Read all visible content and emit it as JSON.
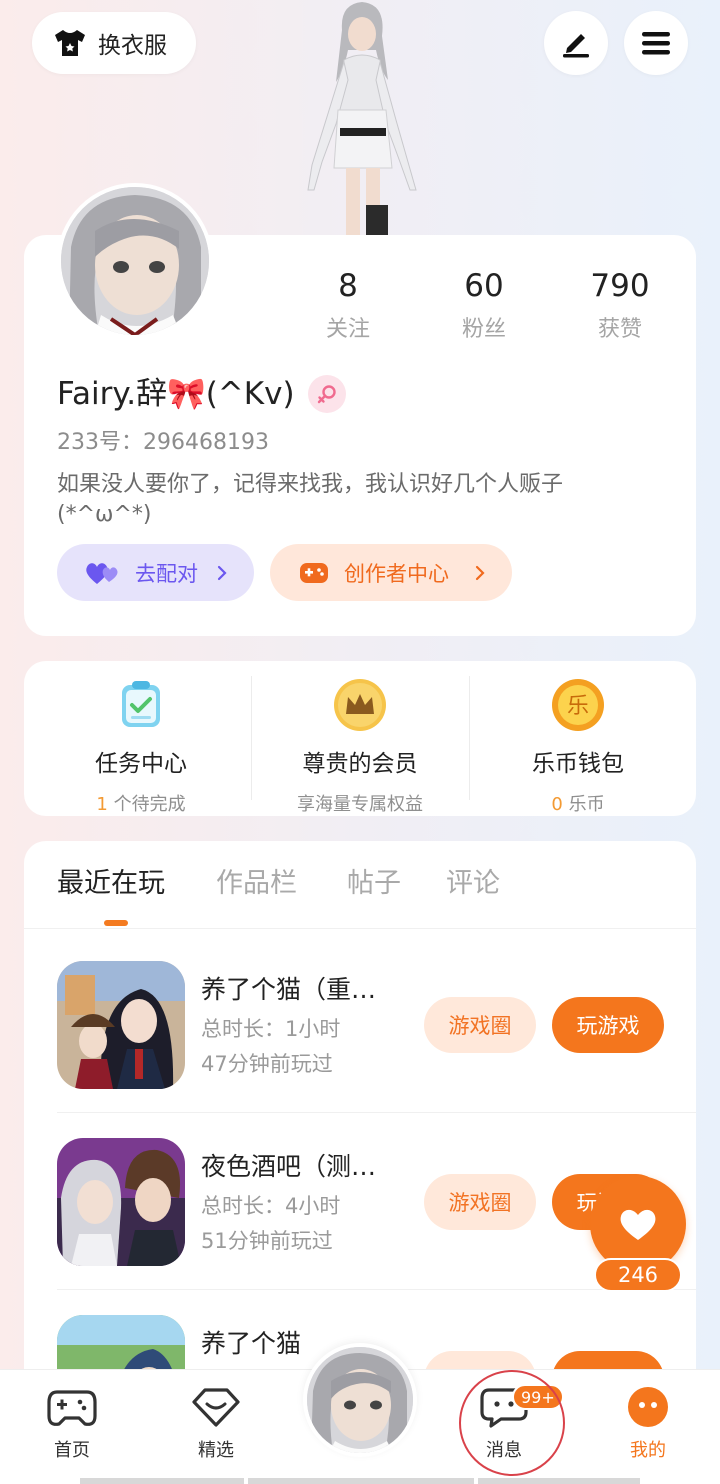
{
  "header": {
    "outfit_label": "换衣服"
  },
  "profile": {
    "stats": [
      {
        "value": "8",
        "label": "关注"
      },
      {
        "value": "60",
        "label": "粉丝"
      },
      {
        "value": "790",
        "label": "获赞"
      }
    ],
    "username": "Fairy.辞🎀(^Kv)",
    "uid": "233号：296468193",
    "bio": "如果没人要你了，记得来找我，我认识好几个人贩子(*^ω^*)",
    "match_label": "去配对",
    "creator_label": "创作者中心"
  },
  "services": [
    {
      "title": "任务中心",
      "count": "1",
      "sub": " 个待完成"
    },
    {
      "title": "尊贵的会员",
      "count": "",
      "sub": "享海量专属权益"
    },
    {
      "title": "乐币钱包",
      "count": "0",
      "sub": " 乐币"
    }
  ],
  "tabs": [
    "最近在玩",
    "作品栏",
    "帖子",
    "评论"
  ],
  "games": [
    {
      "title": "养了个猫（重…",
      "duration": "总时长：1小时",
      "last": "47分钟前玩过",
      "circle": "游戏圈",
      "play": "玩游戏"
    },
    {
      "title": "夜色酒吧（测…",
      "duration": "总时长：4小时",
      "last": "51分钟前玩过",
      "circle": "游戏圈",
      "play": "玩游戏"
    },
    {
      "title": "养了个猫",
      "duration": "",
      "last": "",
      "circle": "",
      "play": ""
    }
  ],
  "float_like": {
    "count": "246"
  },
  "nav": {
    "home": "首页",
    "featured": "精选",
    "messages": "消息",
    "messages_badge": "99+",
    "mine": "我的"
  },
  "colors": {
    "accent": "#f4761d",
    "match_purple": "#6b57ef",
    "background_left": "#fbeceb",
    "background_right": "#e9f1fb"
  }
}
